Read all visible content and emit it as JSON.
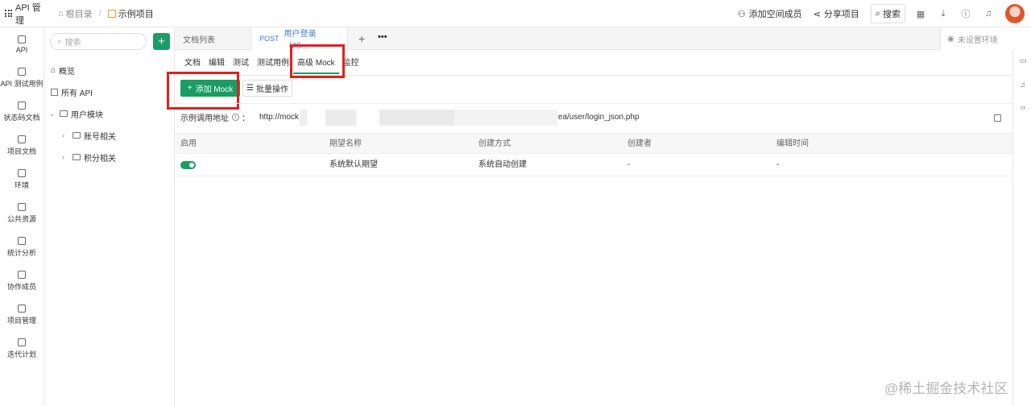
{
  "topbar": {
    "app_title": "API 管理",
    "crumb_home": "根目录",
    "crumb_sep": "/",
    "crumb_current": "示例项目",
    "add_member": "添加空间成员",
    "share": "分享项目",
    "search": "搜索",
    "icons": [
      "calendar-icon",
      "download-icon",
      "help-icon",
      "bell-icon"
    ]
  },
  "leftnav": {
    "items": [
      {
        "label": "API",
        "icon": "api-icon"
      },
      {
        "label": "API 测试用例",
        "icon": "test-case-icon"
      },
      {
        "label": "状态码文档",
        "icon": "status-code-icon"
      },
      {
        "label": "项目文档",
        "icon": "project-doc-icon"
      },
      {
        "label": "环境",
        "icon": "env-icon"
      },
      {
        "label": "公共资源",
        "icon": "resource-icon"
      },
      {
        "label": "统计分析",
        "icon": "stats-icon"
      },
      {
        "label": "协作成员",
        "icon": "members-icon"
      },
      {
        "label": "项目管理",
        "icon": "settings-icon"
      },
      {
        "label": "迭代计划",
        "icon": "plan-icon"
      }
    ]
  },
  "tree": {
    "search_placeholder": "搜索",
    "add": "+",
    "overview": "概览",
    "all_api": "所有 API",
    "group": "用户模块",
    "sub1": "账号相关",
    "sub2": "积分相关"
  },
  "tabs": {
    "doc_list": "文档列表",
    "active_method": "POST",
    "active_title": "用户登录（JS...",
    "plus": "+",
    "more": "•••",
    "env": "未设置环境"
  },
  "subtabs": [
    "文档",
    "编辑",
    "测试",
    "测试用例",
    "高级 Mock",
    "监控"
  ],
  "actions": {
    "add_mock": "添加 Mock",
    "batch": "批量操作"
  },
  "url": {
    "label": "示例调用地址",
    "colon": "：",
    "prefix": "http://mock",
    "suffix": "ea/user/login_json.php"
  },
  "table": {
    "headers": [
      "启用",
      "期望名称",
      "创建方式",
      "创建者",
      "编辑时间"
    ],
    "rows": [
      {
        "enabled": true,
        "name": "系统默认期望",
        "method": "系统自动创建",
        "creator": "-",
        "edited": "-"
      }
    ]
  },
  "watermark": "@稀土掘金技术社区",
  "colors": {
    "accent": "#1a9d64",
    "highlight": "#e0201e",
    "link": "#3d7bd9"
  }
}
